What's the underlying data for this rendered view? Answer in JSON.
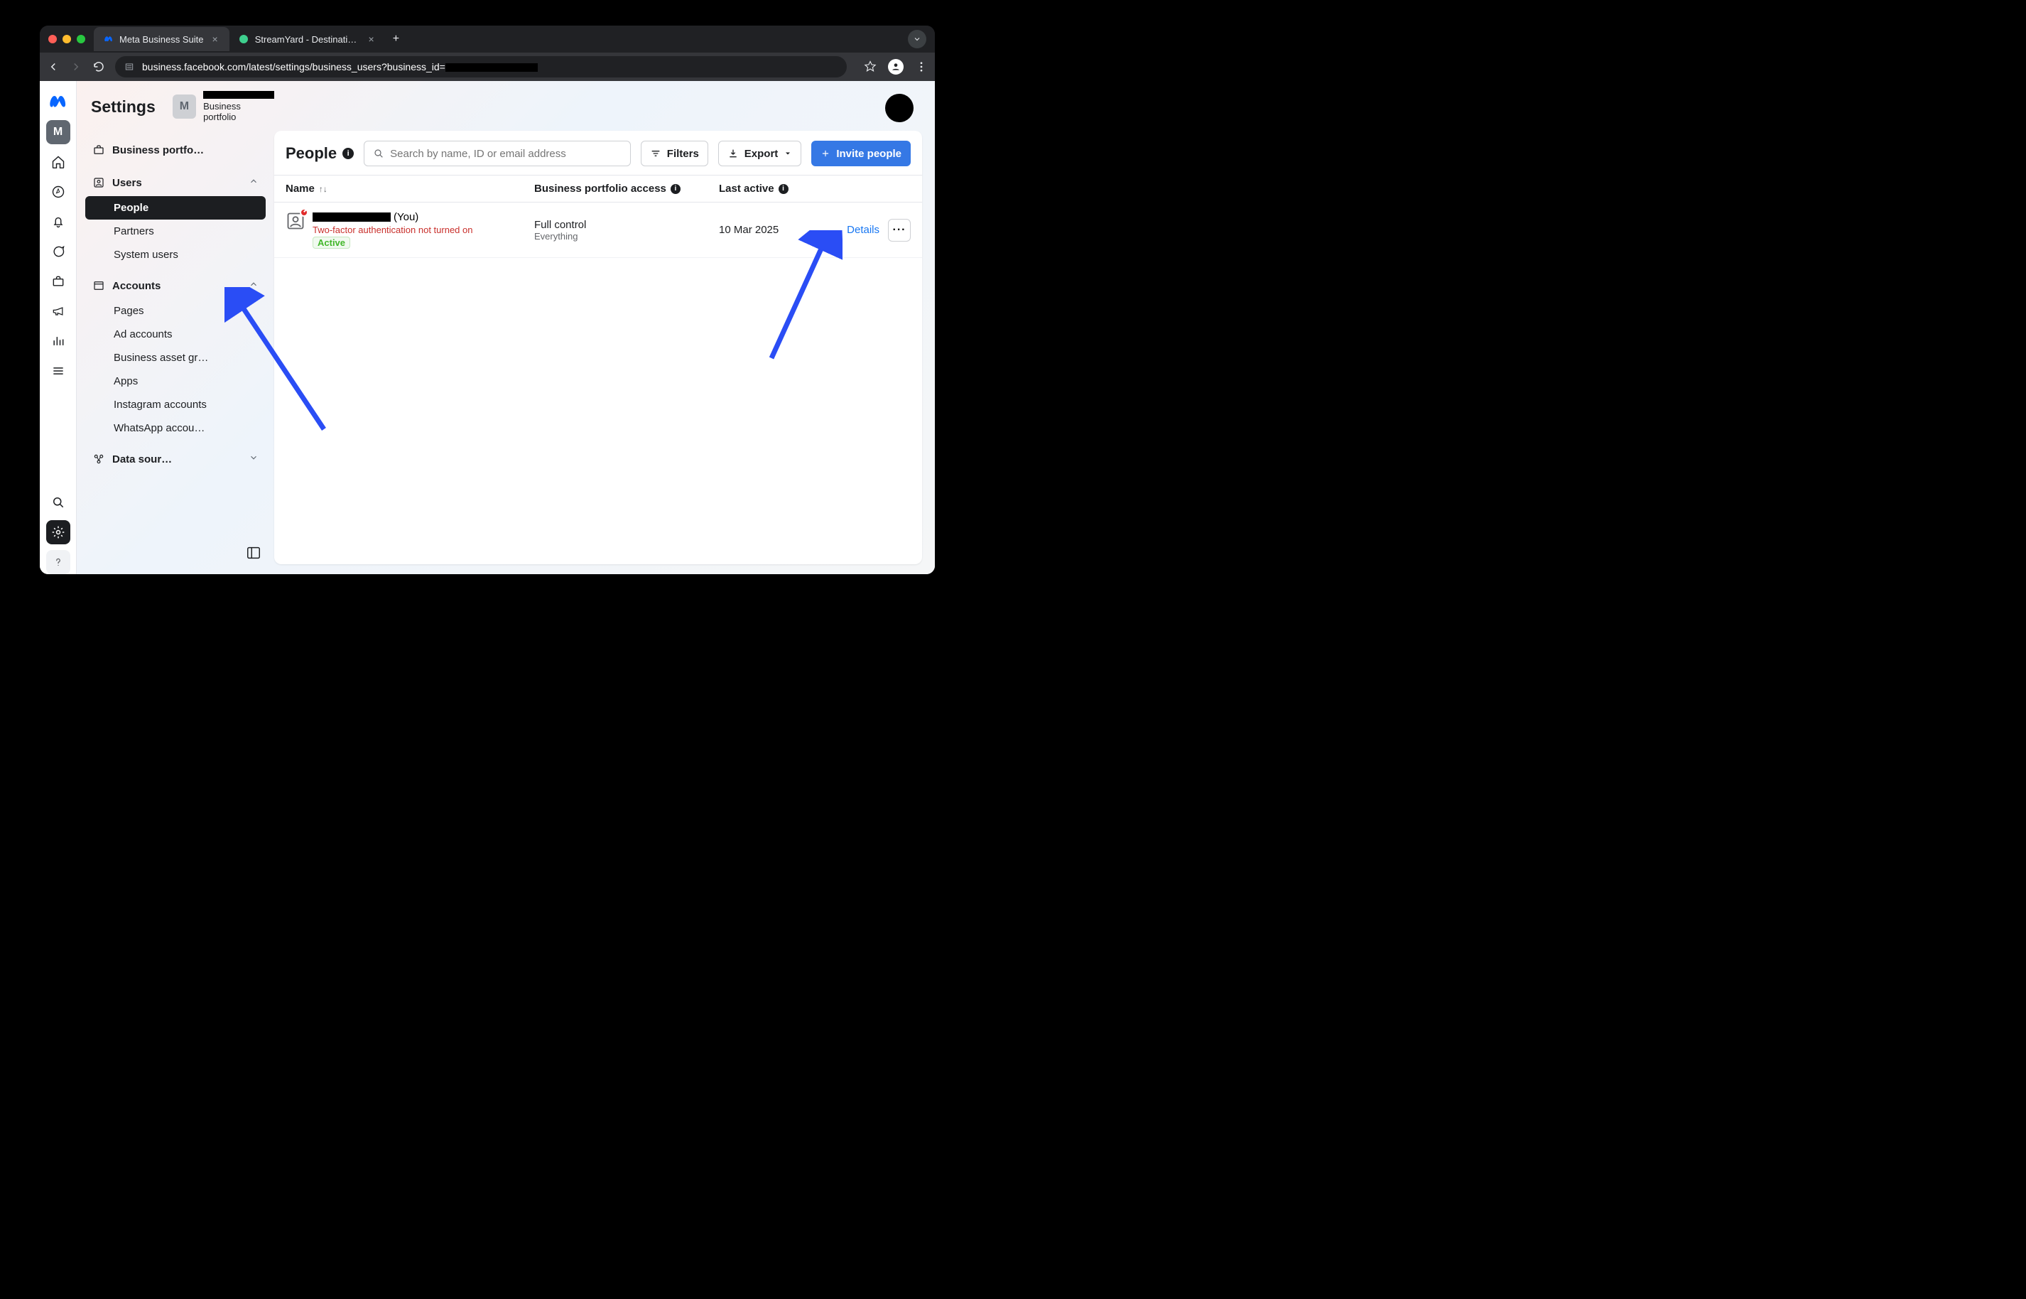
{
  "browser": {
    "tabs": [
      {
        "title": "Meta Business Suite",
        "active": true
      },
      {
        "title": "StreamYard - Destinations",
        "active": false
      }
    ],
    "url_visible": "business.facebook.com/latest/settings/business_users?business_id="
  },
  "rail": {
    "portfolio_letter": "M"
  },
  "header": {
    "settings_title": "Settings",
    "portfolio_letter": "M",
    "portfolio_subtitle": "Business portfolio"
  },
  "sidebar": {
    "portfolio_info": "Business portfo…",
    "users_group": "Users",
    "users_items": {
      "people": "People",
      "partners": "Partners",
      "system_users": "System users"
    },
    "accounts_group": "Accounts",
    "accounts_items": {
      "pages": "Pages",
      "ad_accounts": "Ad accounts",
      "asset_groups": "Business asset gr…",
      "apps": "Apps",
      "instagram": "Instagram accounts",
      "whatsapp": "WhatsApp accou…"
    },
    "data_sources_group": "Data sour…"
  },
  "main": {
    "title": "People",
    "search_placeholder": "Search by name, ID or email address",
    "filters_btn": "Filters",
    "export_btn": "Export",
    "invite_btn": "Invite people",
    "columns": {
      "name": "Name",
      "access": "Business portfolio access",
      "last_active": "Last active"
    },
    "rows": [
      {
        "you_suffix": "(You)",
        "twofa_warning": "Two-factor authentication not turned on",
        "status": "Active",
        "access_level": "Full control",
        "access_scope": "Everything",
        "last_active": "10 Mar 2025",
        "details": "Details"
      }
    ],
    "kebab_label": "···"
  }
}
